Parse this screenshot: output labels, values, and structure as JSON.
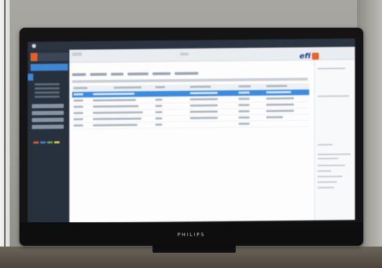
{
  "brand_label": "PHILIPS",
  "screen": {
    "logo_text": "efi",
    "sidebar": {
      "status_colors": [
        "#e05a3a",
        "#3e86d6",
        "#6aa84f",
        "#e6c84a"
      ]
    },
    "table": {
      "rows": 7,
      "selected_row": 1
    }
  }
}
